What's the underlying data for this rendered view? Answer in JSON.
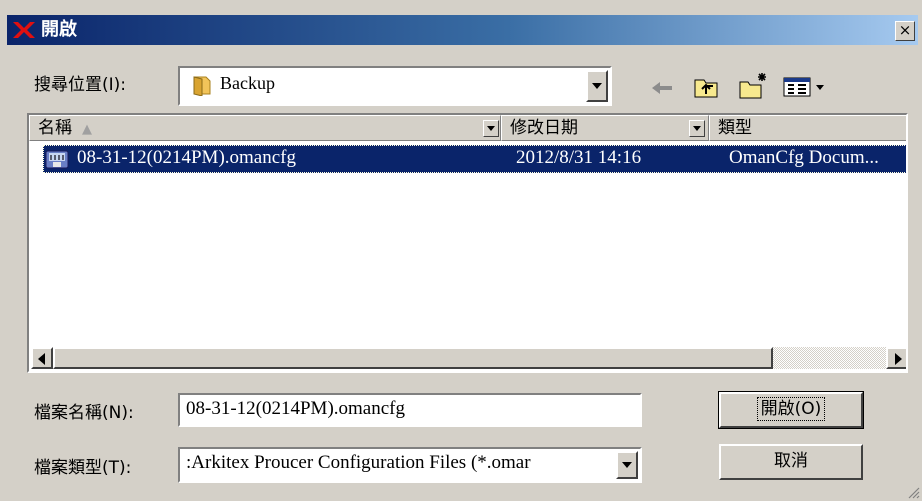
{
  "window": {
    "title": "開啟",
    "close_label": "×"
  },
  "lookin": {
    "label": "搜尋位置(I):",
    "value": "Backup"
  },
  "toolbar": {
    "back_icon": "back-arrow-icon",
    "up_icon": "up-folder-icon",
    "new_folder_icon": "new-folder-icon",
    "view_icon": "view-menu-icon"
  },
  "list": {
    "columns": [
      "名稱",
      "修改日期",
      "類型"
    ],
    "rows": [
      {
        "name": "08-31-12(0214PM).omancfg",
        "modified": "2012/8/31 14:16",
        "type": "OmanCfg Docum...",
        "selected": true
      }
    ]
  },
  "filename": {
    "label": "檔案名稱(N):",
    "value": "08-31-12(0214PM).omancfg"
  },
  "filetype": {
    "label": "檔案類型(T):",
    "value": ":Arkitex Proucer Configuration Files (*.omar"
  },
  "buttons": {
    "open": "開啟(O)",
    "cancel": "取消"
  },
  "colors": {
    "title_start": "#0a246a",
    "title_end": "#a6caf0",
    "selection": "#0a246a",
    "face": "#d4d0c8"
  }
}
